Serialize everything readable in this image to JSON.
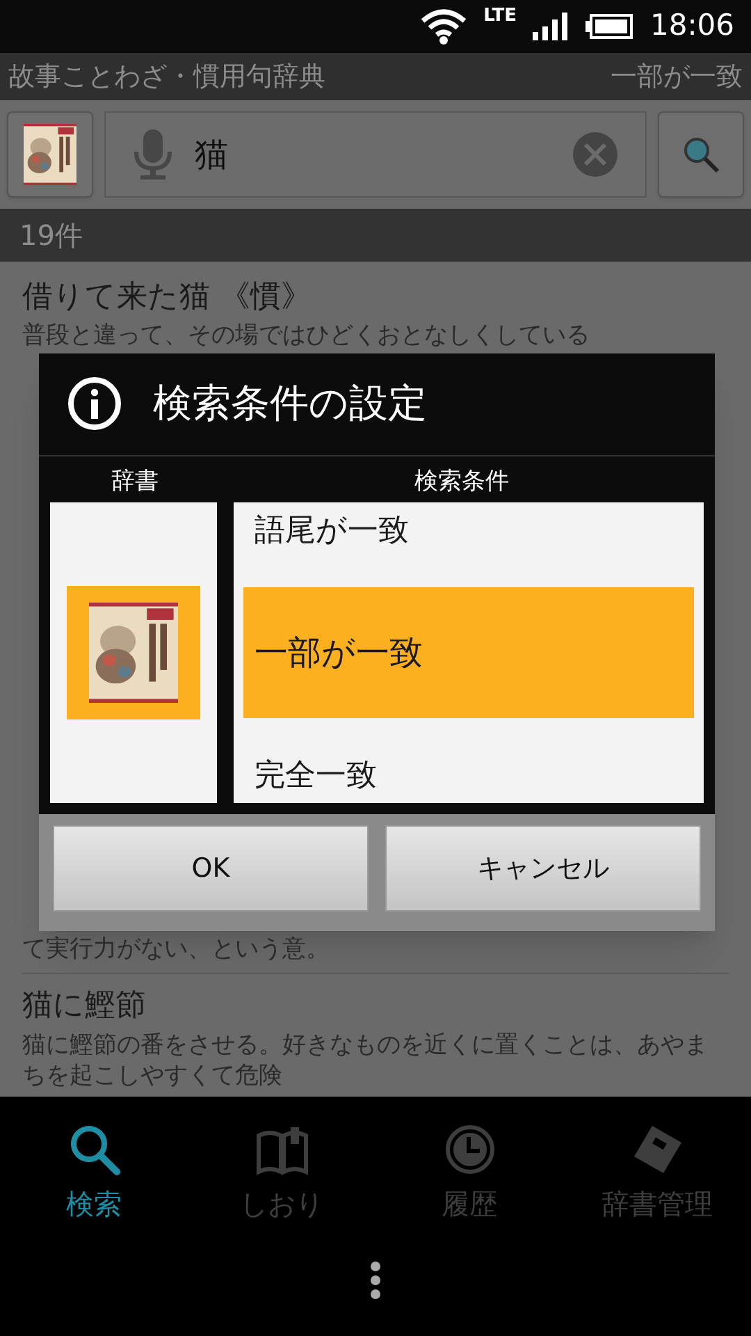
{
  "status_bar": {
    "network": "LTE",
    "time": "18:06"
  },
  "app_bar": {
    "title": "故事ことわざ・慣用句辞典",
    "match_mode": "一部が一致"
  },
  "search": {
    "value": "猫"
  },
  "results": {
    "count": "19件",
    "items": [
      {
        "title": "借りて来た猫 《慣》",
        "description": "普段と違って、その場ではひどくおとなしくしている"
      },
      {
        "description": "て実行力がない、という意。"
      },
      {
        "title": "猫に鰹節",
        "description": "猫に鰹節の番をさせる。好きなものを近くに置くことは、あやまちを起こしやすくて危険"
      }
    ]
  },
  "dialog": {
    "title": "検索条件の設定",
    "columns": [
      "辞書",
      "検索条件"
    ],
    "dictionaries": [
      {
        "kind": "picture",
        "selected": true
      }
    ],
    "conditions": [
      {
        "label": "語尾が一致",
        "selected": false
      },
      {
        "label": "一部が一致",
        "selected": true
      },
      {
        "label": "完全一致",
        "selected": false
      }
    ],
    "buttons": [
      "OK",
      "キャンセル"
    ]
  },
  "nav": [
    {
      "kind": "search",
      "label": "検索",
      "selected": true
    },
    {
      "kind": "bookmark",
      "label": "しおり",
      "selected": false
    },
    {
      "kind": "history",
      "label": "履歴",
      "selected": false
    },
    {
      "kind": "dictionary",
      "label": "辞書管理",
      "selected": false
    }
  ]
}
